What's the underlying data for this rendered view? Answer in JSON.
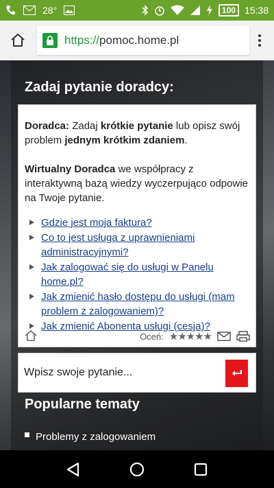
{
  "status_bar": {
    "temperature": "28°",
    "battery": "100",
    "time": "15:38"
  },
  "browser": {
    "url_scheme": "https://",
    "url_host": "pomoc.home.pl"
  },
  "chat": {
    "title": "Zadaj pytanie doradcy:",
    "intro": {
      "label": "Doradca:",
      "part1": " Zadaj ",
      "bold1": "krótkie pytanie",
      "part2": " lub opisz swój problem ",
      "bold2": "jednym krótkim zdaniem",
      "part3": "."
    },
    "virtual": {
      "label": "Wirtualny Doradca",
      "text": " we współpracy z interaktywną bazą wiedzy wyczerpująco odpowie na Twoje pytanie."
    },
    "links": [
      "Gdzie jest moja faktura?",
      "Co to jest usługa z uprawnieniami administracyjnymi?",
      "Jak zalogować się do usługi w Panelu home.pl?",
      "Jak zmienić hasło dostępu do usługi (mam problem z zalogowaniem)?",
      "Jak zmienić Abonenta usługi (cesja)?"
    ],
    "rate_label": "Oceń:",
    "stars": "★★★★★"
  },
  "question_input": {
    "placeholder": "Wpisz swoje pytanie..."
  },
  "popular": {
    "title": "Popularne tematy",
    "items": [
      "Problemy z zalogowaniem"
    ]
  },
  "colors": {
    "status_bar": "#6aa32b",
    "lock_green": "#1e9a3a",
    "send_red": "#e3151b",
    "link_blue": "#1a3f8a"
  }
}
